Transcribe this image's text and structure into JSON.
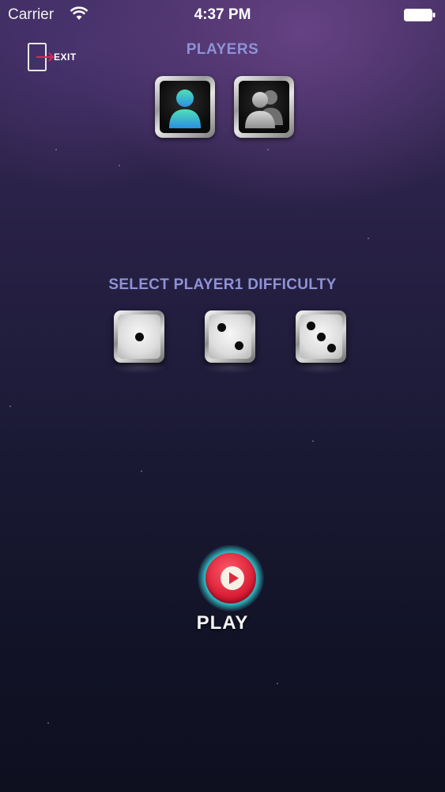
{
  "status_bar": {
    "carrier": "Carrier",
    "time": "4:37 PM",
    "icons": [
      "wifi-icon",
      "battery-icon"
    ]
  },
  "header": {
    "exit_label": "EXIT",
    "exit_icon": "exit-door-icon",
    "players_title": "PLAYERS"
  },
  "players": {
    "options": [
      {
        "id": "single",
        "icon": "single-player-icon",
        "selected": true
      },
      {
        "id": "multi",
        "icon": "multi-player-icon",
        "selected": false
      }
    ]
  },
  "difficulty": {
    "title": "SELECT PLAYER1 DIFFICULTY",
    "options": [
      {
        "id": "easy",
        "icon": "dice-one-icon",
        "pips": 1
      },
      {
        "id": "medium",
        "icon": "dice-two-icon",
        "pips": 2
      },
      {
        "id": "hard",
        "icon": "dice-three-icon",
        "pips": 3
      }
    ]
  },
  "play": {
    "label": "PLAY",
    "icon": "play-icon"
  },
  "colors": {
    "title_text": "#8f92d6",
    "play_red": "#d4152e",
    "play_ring": "#2fb8c2",
    "single_player_teal": "#36c5c0"
  }
}
